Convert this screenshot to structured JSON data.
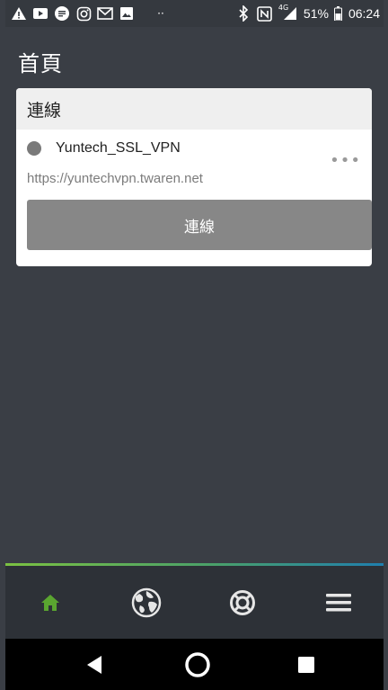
{
  "status_bar": {
    "left_icons": [
      "warning-icon",
      "video-icon",
      "news-icon",
      "instagram-icon",
      "gmail-icon",
      "image-icon",
      "more-dots-icon"
    ],
    "right_icons": [
      "bluetooth-icon",
      "nfc-icon",
      "signal-4g-icon",
      "battery-icon"
    ],
    "network_label": "4G",
    "battery": "51%",
    "time": "06:24"
  },
  "page": {
    "title": "首頁"
  },
  "card": {
    "header": "連線",
    "connection": {
      "name": "Yuntech_SSL_VPN",
      "url": "https://yuntechvpn.twaren.net",
      "status_color": "#7a7a7a",
      "more_label": "•••"
    },
    "connect_button": "連線"
  },
  "bottom_nav": {
    "items": [
      {
        "icon": "home-icon",
        "active": true
      },
      {
        "icon": "globe-icon",
        "active": false
      },
      {
        "icon": "lifebuoy-icon",
        "active": false
      },
      {
        "icon": "menu-icon",
        "active": false
      }
    ],
    "active_color": "#5aa530"
  },
  "system_nav": [
    "back-icon",
    "home-circle-icon",
    "recents-icon"
  ]
}
